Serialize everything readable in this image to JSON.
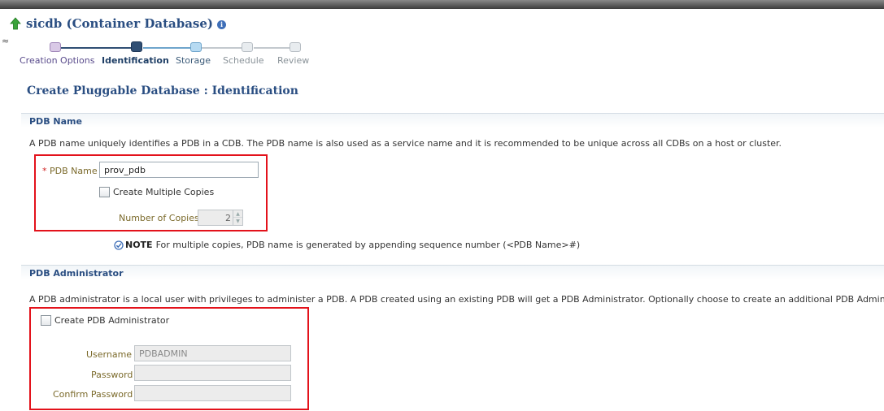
{
  "header": {
    "title": "sicdb (Container Database)",
    "info_icon": "i",
    "left_mark": "≈"
  },
  "train": {
    "steps": [
      {
        "label": "Creation Options",
        "state": "visited"
      },
      {
        "label": "Identification",
        "state": "current"
      },
      {
        "label": "Storage",
        "state": "next"
      },
      {
        "label": "Schedule",
        "state": "future"
      },
      {
        "label": "Review",
        "state": "future"
      }
    ]
  },
  "page_title": "Create Pluggable Database : Identification",
  "pdb_name_section": {
    "header": "PDB Name",
    "description": "A PDB name uniquely identifies a PDB in a CDB. The PDB name is also used as a service name and it is recommended to be unique across all CDBs on a host or cluster.",
    "required_mark": "*",
    "name_label": "PDB Name",
    "name_value": "prov_pdb",
    "multiple_copies_label": "Create Multiple Copies",
    "multiple_copies_checked": false,
    "copies_label": "Number of Copies",
    "copies_value": "2",
    "note_label": "NOTE",
    "note_text": "For multiple copies, PDB name is generated by appending sequence number (<PDB Name>#)"
  },
  "pdb_admin_section": {
    "header": "PDB Administrator",
    "description": "A PDB administrator is a local user with privileges to administer a PDB. A PDB created using an existing PDB will get a PDB Administrator. Optionally choose to create an additional PDB Administrator.",
    "create_admin_label": "Create PDB Administrator",
    "create_admin_checked": false,
    "username_label": "Username",
    "username_value": "PDBADMIN",
    "password_label": "Password",
    "password_value": "",
    "confirm_label": "Confirm Password",
    "confirm_value": ""
  },
  "colors": {
    "title_blue": "#2a4e82",
    "highlight_red": "#e3121b",
    "train_current": "#304f74",
    "label_gold": "#7b6a2b"
  }
}
